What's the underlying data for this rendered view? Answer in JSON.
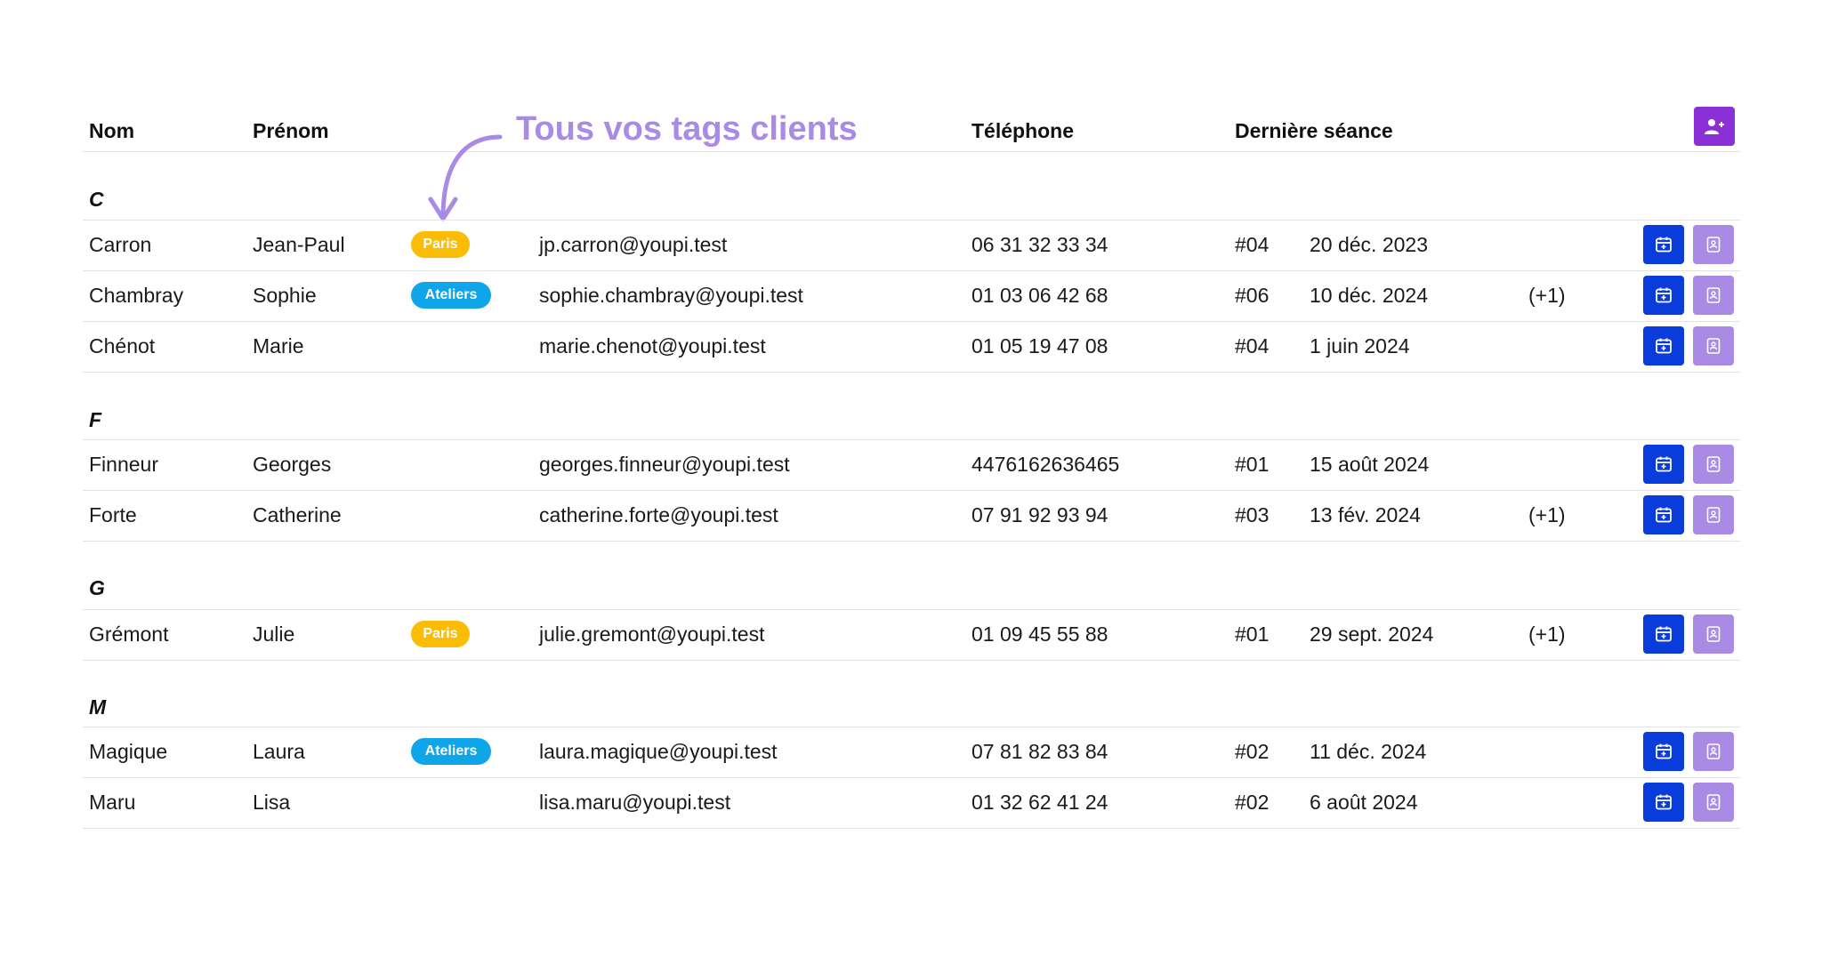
{
  "annotation": {
    "text": "Tous vos tags clients"
  },
  "header": {
    "nom": "Nom",
    "prenom": "Prénom",
    "telephone": "Téléphone",
    "derniere_seance": "Dernière séance"
  },
  "colors": {
    "tag_paris": "#fbbc05",
    "tag_ateliers": "#0ea5e9",
    "calendar_button": "#0a3bdb",
    "contact_button": "#a98be6",
    "add_client_button": "#8b2fd6",
    "annotation": "#a98be6"
  },
  "groups": [
    {
      "letter": "C",
      "rows": [
        {
          "nom": "Carron",
          "prenom": "Jean-Paul",
          "tag": "Paris",
          "tag_type": "paris",
          "email": "jp.carron@youpi.test",
          "telephone": "06 31 32 33 34",
          "seance": "#04",
          "date": "20 déc. 2023",
          "extra": ""
        },
        {
          "nom": "Chambray",
          "prenom": "Sophie",
          "tag": "Ateliers",
          "tag_type": "ateliers",
          "email": "sophie.chambray@youpi.test",
          "telephone": "01 03 06 42 68",
          "seance": "#06",
          "date": "10 déc. 2024",
          "extra": "(+1)"
        },
        {
          "nom": "Chénot",
          "prenom": "Marie",
          "tag": "",
          "tag_type": "",
          "email": "marie.chenot@youpi.test",
          "telephone": "01 05 19 47 08",
          "seance": "#04",
          "date": "1 juin 2024",
          "extra": ""
        }
      ]
    },
    {
      "letter": "F",
      "rows": [
        {
          "nom": "Finneur",
          "prenom": "Georges",
          "tag": "",
          "tag_type": "",
          "email": "georges.finneur@youpi.test",
          "telephone": "4476162636465",
          "seance": "#01",
          "date": "15 août 2024",
          "extra": ""
        },
        {
          "nom": "Forte",
          "prenom": "Catherine",
          "tag": "",
          "tag_type": "",
          "email": "catherine.forte@youpi.test",
          "telephone": "07 91 92 93 94",
          "seance": "#03",
          "date": "13 fév. 2024",
          "extra": "(+1)"
        }
      ]
    },
    {
      "letter": "G",
      "rows": [
        {
          "nom": "Grémont",
          "prenom": "Julie",
          "tag": "Paris",
          "tag_type": "paris",
          "email": "julie.gremont@youpi.test",
          "telephone": "01 09 45 55 88",
          "seance": "#01",
          "date": "29 sept. 2024",
          "extra": "(+1)"
        }
      ]
    },
    {
      "letter": "M",
      "rows": [
        {
          "nom": "Magique",
          "prenom": "Laura",
          "tag": "Ateliers",
          "tag_type": "ateliers",
          "email": "laura.magique@youpi.test",
          "telephone": "07 81 82 83 84",
          "seance": "#02",
          "date": "11 déc. 2024",
          "extra": ""
        },
        {
          "nom": "Maru",
          "prenom": "Lisa",
          "tag": "",
          "tag_type": "",
          "email": "lisa.maru@youpi.test",
          "telephone": "01 32 62 41 24",
          "seance": "#02",
          "date": "6 août 2024",
          "extra": ""
        }
      ]
    }
  ]
}
